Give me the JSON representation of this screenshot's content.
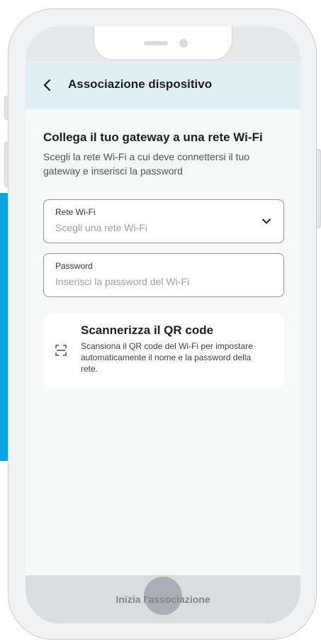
{
  "header": {
    "back_icon": "chevron-left-icon",
    "title": "Associazione dispositivo"
  },
  "section": {
    "title": "Collega il tuo gateway a una rete Wi-Fi",
    "description": "Scegli la rete Wi-Fi a cui deve connettersi il tuo gateway e inserisci la password"
  },
  "wifi_field": {
    "label": "Rete Wi-Fi",
    "placeholder": "Scegli una rete Wi-Fi",
    "icon": "chevron-down-icon"
  },
  "password_field": {
    "label": "Password",
    "placeholder": "Inserisci la password del Wi-Fi"
  },
  "qr_card": {
    "icon": "qr-scan-icon",
    "title": "Scannerizza il QR code",
    "description": "Scansiona il QR code del Wi-Fi per impostare automaticamente il nome e la password della rete."
  },
  "footer": {
    "primary_label": "Inizia l'associazione"
  },
  "colors": {
    "header_bg": "#e1eff6",
    "accent_blue": "#0aa2e0",
    "button_disabled_bg": "#dadde0"
  }
}
